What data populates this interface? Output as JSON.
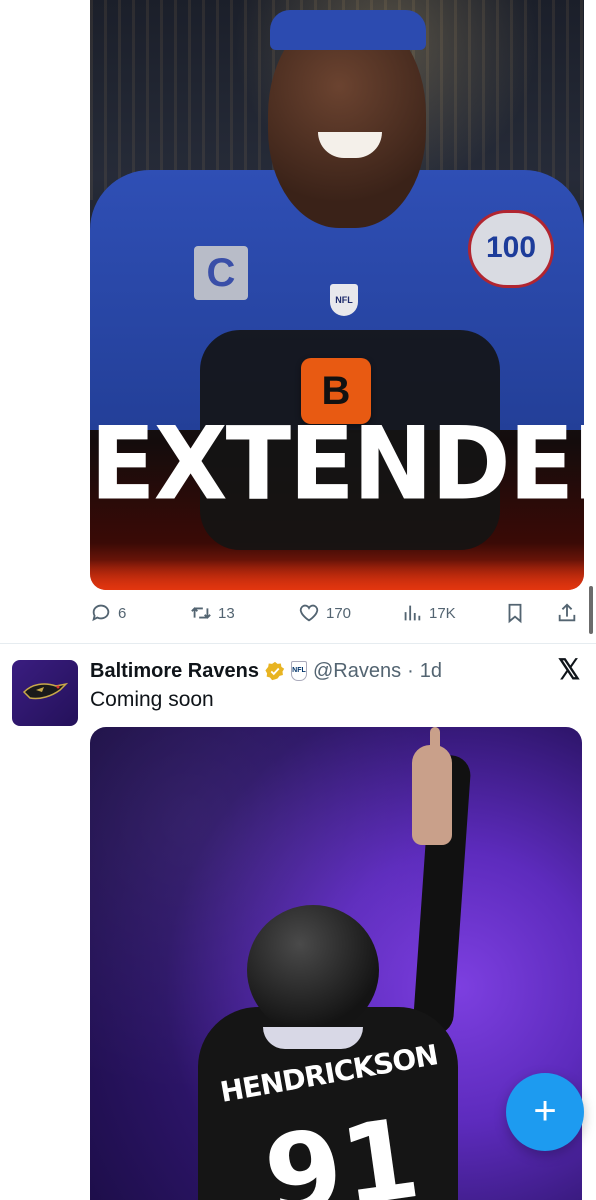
{
  "tweet1": {
    "media": {
      "headline": "EXTENDED",
      "captain_patch": "C",
      "anniversary_badge": "100",
      "team_logo_glyph": "B"
    },
    "actions": [
      {
        "icon": "reply-icon",
        "count": "6"
      },
      {
        "icon": "retweet-icon",
        "count": "13"
      },
      {
        "icon": "like-icon",
        "count": "170"
      },
      {
        "icon": "views-icon",
        "count": "17K"
      },
      {
        "icon": "bookmark-icon",
        "count": ""
      },
      {
        "icon": "share-icon",
        "count": ""
      }
    ]
  },
  "tweet2": {
    "author": {
      "name": "Baltimore Ravens",
      "handle": "@Ravens",
      "separator": "·",
      "time": "1d"
    },
    "text": "Coming soon",
    "media": {
      "jersey_name": "HENDRICKSON",
      "jersey_number": "91"
    }
  },
  "fab": {
    "label": "+"
  },
  "colors": {
    "accent": "#1d9bf0",
    "muted": "#536471",
    "ravens_purple": "#24115a",
    "bengals_orange": "#e85a12"
  }
}
